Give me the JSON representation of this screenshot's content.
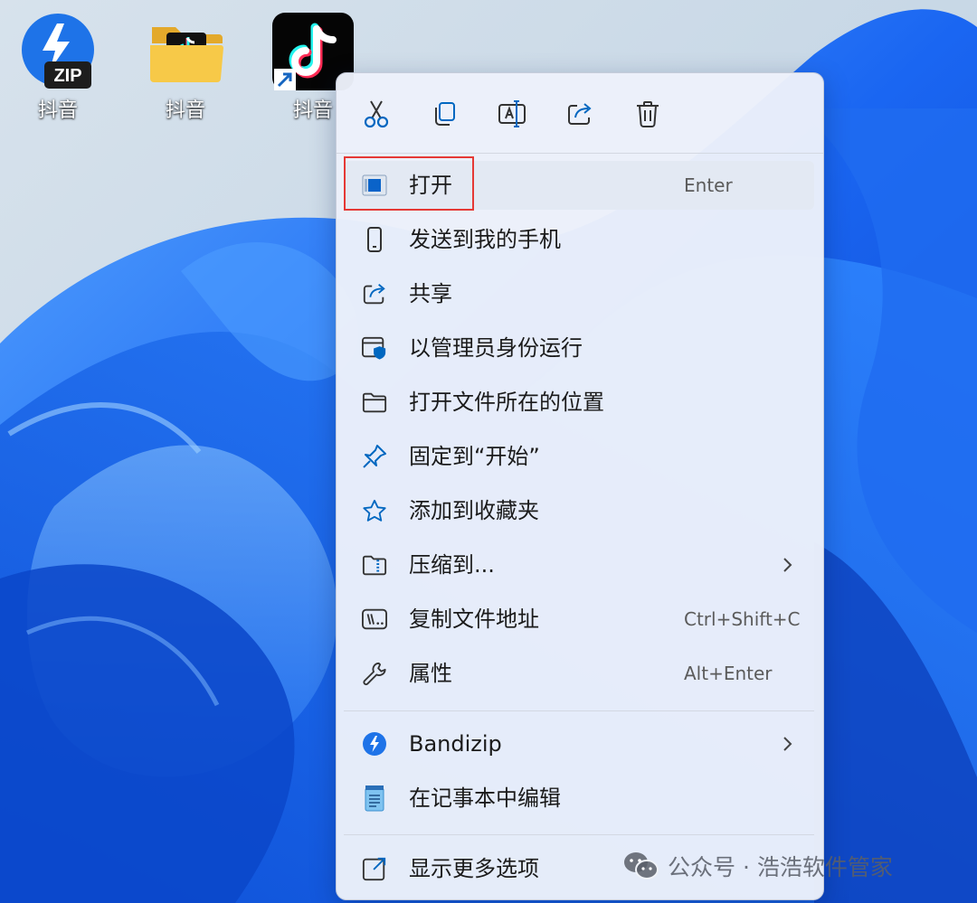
{
  "desktop": {
    "icons": [
      {
        "label": "抖音",
        "badge": "ZIP"
      },
      {
        "label": "抖音"
      },
      {
        "label": "抖音"
      }
    ]
  },
  "context_menu": {
    "toolbar": [
      "cut-icon",
      "copy-icon",
      "rename-icon",
      "share-icon",
      "delete-icon"
    ],
    "items": [
      {
        "label": "打开",
        "shortcut": "Enter",
        "icon": "app-window-icon"
      },
      {
        "label": "发送到我的手机",
        "icon": "phone-icon"
      },
      {
        "label": "共享",
        "icon": "share-icon"
      },
      {
        "label": "以管理员身份运行",
        "icon": "shield-window-icon"
      },
      {
        "label": "打开文件所在的位置",
        "icon": "folder-icon"
      },
      {
        "label": "固定到“开始”",
        "icon": "pin-icon"
      },
      {
        "label": "添加到收藏夹",
        "icon": "star-icon"
      },
      {
        "label": "压缩到...",
        "icon": "zip-folder-icon",
        "submenu": true
      },
      {
        "label": "复制文件地址",
        "shortcut": "Ctrl+Shift+C",
        "icon": "path-copy-icon"
      },
      {
        "label": "属性",
        "shortcut": "Alt+Enter",
        "icon": "wrench-icon"
      },
      {
        "label": "Bandizip",
        "icon": "bandizip-icon",
        "submenu": true
      },
      {
        "label": "在记事本中编辑",
        "icon": "notepad-icon"
      },
      {
        "label": "显示更多选项",
        "icon": "more-options-icon"
      }
    ]
  },
  "watermark": {
    "text": "公众号 · 浩浩软件管家"
  },
  "colors": {
    "accent": "#0067c0",
    "highlight_border": "#e53935"
  }
}
